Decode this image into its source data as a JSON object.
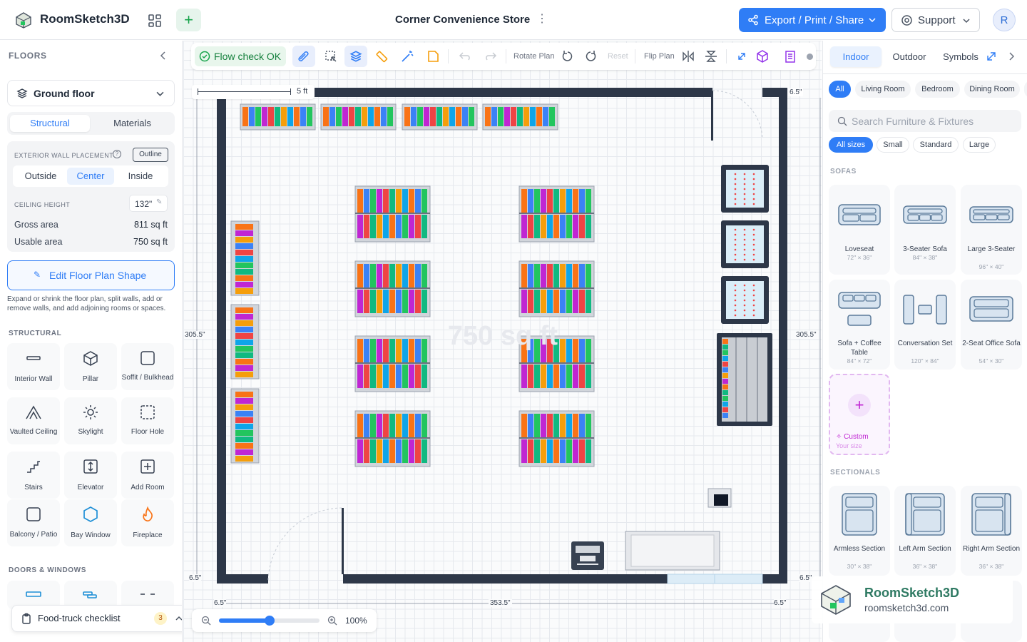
{
  "app": {
    "name": "RoomSketch3D",
    "project_title": "Corner Convenience Store",
    "export_label": "Export / Print / Share",
    "support_label": "Support",
    "avatar_initial": "R"
  },
  "left": {
    "floors_title": "FLOORS",
    "floor_name": "Ground floor",
    "tabs": [
      {
        "label": "Structural",
        "active": true
      },
      {
        "label": "Materials",
        "active": false
      }
    ],
    "wall_placement_label": "EXTERIOR WALL PLACEMENT",
    "outline_label": "Outline",
    "placement_options": [
      {
        "label": "Outside",
        "active": false
      },
      {
        "label": "Center",
        "active": true
      },
      {
        "label": "Inside",
        "active": false
      }
    ],
    "ceiling_label": "CEILING HEIGHT",
    "ceiling_value": "132\"",
    "gross_label": "Gross area",
    "gross_value": "811 sq ft",
    "usable_label": "Usable area",
    "usable_value": "750 sq ft",
    "edit_shape_label": "Edit Floor Plan Shape",
    "edit_hint": "Expand or shrink the floor plan, split walls, add or remove walls, and add adjoining rooms or spaces.",
    "structural_title": "STRUCTURAL",
    "structural_items": [
      {
        "label": "Interior Wall",
        "icon": "interior-wall-icon"
      },
      {
        "label": "Pillar",
        "icon": "pillar-icon"
      },
      {
        "label": "Soffit / Bulkhead",
        "icon": "soffit-icon"
      },
      {
        "label": "Vaulted Ceiling",
        "icon": "vaulted-ceiling-icon"
      },
      {
        "label": "Skylight",
        "icon": "skylight-icon"
      },
      {
        "label": "Floor Hole",
        "icon": "floor-hole-icon"
      },
      {
        "label": "Stairs",
        "icon": "stairs-icon"
      },
      {
        "label": "Elevator",
        "icon": "elevator-icon"
      },
      {
        "label": "Add Room",
        "icon": "add-room-icon"
      },
      {
        "label": "Balcony / Patio",
        "icon": "balcony-icon"
      },
      {
        "label": "Bay Window",
        "icon": "bay-window-icon"
      },
      {
        "label": "Fireplace",
        "icon": "fireplace-icon"
      }
    ],
    "doors_title": "DOORS & WINDOWS",
    "checklist_label": "Food-truck checklist",
    "checklist_count": "3"
  },
  "toolbar": {
    "flow_check": "Flow check OK",
    "rotate_label": "Rotate Plan",
    "reset_label": "Reset",
    "flip_label": "Flip Plan"
  },
  "canvas": {
    "scale_label": "5 ft",
    "area_watermark": "750 sq ft",
    "dims": {
      "wall_top_right": "6.5\"",
      "height_left": "305.5\"",
      "height_right": "305.5\"",
      "wall_bottom_left": "6.5\"",
      "wall_bottom_right": "6.5\"",
      "bottom_left": "6.5\"",
      "width": "353.5\"",
      "bottom_right": "6.5\""
    },
    "zoom_label": "100%",
    "zoom_level": 0.5
  },
  "right": {
    "tabs": [
      {
        "label": "Indoor",
        "active": true
      },
      {
        "label": "Outdoor",
        "active": false
      },
      {
        "label": "Symbols",
        "active": false
      }
    ],
    "rooms": [
      {
        "label": "All",
        "active": true
      },
      {
        "label": "Living Room"
      },
      {
        "label": "Bedroom"
      },
      {
        "label": "Dining Room"
      }
    ],
    "search_placeholder": "Search Furniture & Fixtures",
    "sizes": [
      {
        "label": "All sizes",
        "active": true
      },
      {
        "label": "Small"
      },
      {
        "label": "Standard"
      },
      {
        "label": "Large"
      }
    ],
    "sofas_title": "SOFAS",
    "sofas": [
      {
        "name": "Loveseat",
        "size": "72\" × 36\""
      },
      {
        "name": "3-Seater Sofa",
        "size": "84\" × 38\""
      },
      {
        "name": "Large 3-Seater",
        "size": "96\" × 40\""
      },
      {
        "name": "Sofa + Coffee Table",
        "size": "84\" × 72\""
      },
      {
        "name": "Conversation Set",
        "size": "120\" × 84\""
      },
      {
        "name": "2-Seat Office Sofa",
        "size": "54\" × 30\""
      }
    ],
    "custom_label": "Custom",
    "custom_sub": "Your size",
    "sectionals_title": "SECTIONALS",
    "sectionals": [
      {
        "name": "Armless Section",
        "size": "30\" × 38\""
      },
      {
        "name": "Left Arm Section",
        "size": "36\" × 38\""
      },
      {
        "name": "Right Arm Section",
        "size": "36\" × 38\""
      }
    ]
  },
  "watermark": {
    "name": "RoomSketch3D",
    "url": "roomsketch3d.com"
  }
}
